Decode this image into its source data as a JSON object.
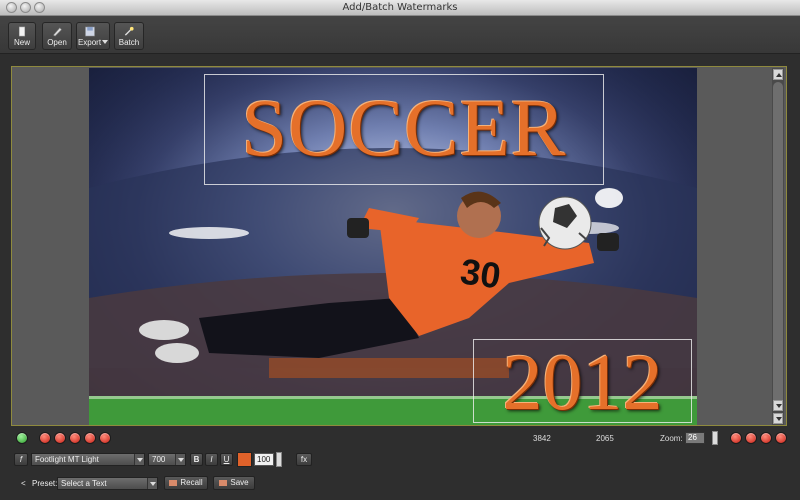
{
  "window": {
    "title": "Add/Batch Watermarks"
  },
  "toolbar": {
    "new_label": "New",
    "open_label": "Open",
    "export_label": "Export",
    "batch_label": "Batch"
  },
  "canvas": {
    "watermarks": [
      {
        "text": "SOCCER"
      },
      {
        "text": "2012"
      }
    ],
    "jersey_number": "30",
    "accent_color": "#e5702a"
  },
  "status": {
    "width": "3842",
    "height": "2065",
    "zoom_label": "Zoom:",
    "zoom_value": "26"
  },
  "format": {
    "font_name": "Footlight MT Light",
    "font_weight": "700",
    "bold_label": "B",
    "italic_label": "I",
    "underline_label": "U",
    "color_swatch": "#e0622a",
    "opacity": "100",
    "fx_label": "fx",
    "font_icon_label": "f"
  },
  "preset": {
    "label": "Preset:",
    "select_value": "Select a Text",
    "recall_label": "Recall",
    "save_label": "Save",
    "collapse_glyph": "<"
  }
}
